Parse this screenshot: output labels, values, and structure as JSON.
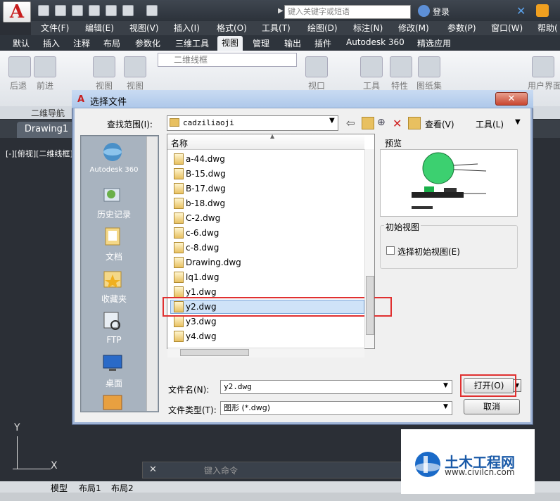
{
  "app": {
    "logo_letter": "A",
    "search_placeholder": "键入关键字或短语",
    "login": "登录"
  },
  "menu": [
    "文件(F)",
    "编辑(E)",
    "视图(V)",
    "插入(I)",
    "格式(O)",
    "工具(T)",
    "绘图(D)",
    "标注(N)",
    "修改(M)",
    "参数(P)",
    "窗口(W)",
    "帮助("
  ],
  "ribbon_tabs": [
    "默认",
    "插入",
    "注释",
    "布局",
    "参数化",
    "三维工具",
    "视图",
    "管理",
    "输出",
    "插件",
    "Autodesk 360",
    "精选应用"
  ],
  "ribbon": {
    "visual_style": "二维线框",
    "buttons": [
      "后退",
      "前进",
      "视图",
      "视图",
      "视口",
      "工具",
      "特性",
      "图纸集",
      "用户界面"
    ],
    "panel_label": "二维导航"
  },
  "drawing": {
    "tab": "Drawing1",
    "view_label": "[-][俯视][二维线框]",
    "ucs_x": "X",
    "ucs_y": "Y",
    "command_placeholder": "键入命令",
    "layout_tabs": [
      "模型",
      "布局1",
      "布局2"
    ]
  },
  "dialog": {
    "title": "选择文件",
    "lookin_label": "查找范围(I):",
    "lookin_value": "cadziliaoji",
    "views_label": "查看(V)",
    "tools_label": "工具(L)",
    "places": [
      "Autodesk 360",
      "历史记录",
      "文档",
      "收藏夹",
      "FTP",
      "桌面"
    ],
    "column_name": "名称",
    "files": [
      "a-44.dwg",
      "B-15.dwg",
      "B-17.dwg",
      "b-18.dwg",
      "C-2.dwg",
      "c-6.dwg",
      "c-8.dwg",
      "Drawing.dwg",
      "lq1.dwg",
      "y1.dwg",
      "y2.dwg",
      "y3.dwg",
      "y4.dwg"
    ],
    "selected_file": "y2.dwg",
    "preview_label": "预览",
    "initial_view_group": "初始视图",
    "initial_view_checkbox": "选择初始视图(E)",
    "initial_view_checked": false,
    "filename_label": "文件名(N):",
    "filename_value": "y2.dwg",
    "filetype_label": "文件类型(T):",
    "filetype_value": "图形 (*.dwg)",
    "open_button": "打开(O)",
    "cancel_button": "取消"
  },
  "watermark": {
    "title": "土木工程网",
    "url": "www.civilcn.com"
  },
  "colors": {
    "highlight": "#e03030",
    "selection": "#cfe3f8",
    "dialog_title": "#aec8ea"
  }
}
